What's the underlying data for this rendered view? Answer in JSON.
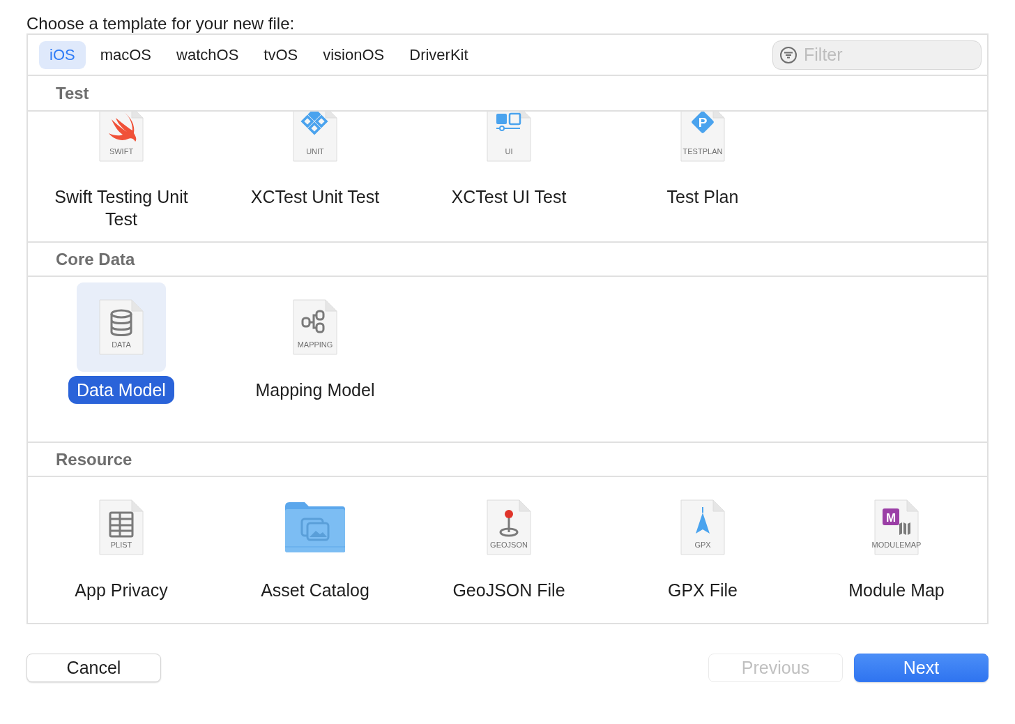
{
  "prompt": "Choose a template for your new file:",
  "tabs": [
    {
      "label": "iOS",
      "selected": true
    },
    {
      "label": "macOS",
      "selected": false
    },
    {
      "label": "watchOS",
      "selected": false
    },
    {
      "label": "tvOS",
      "selected": false
    },
    {
      "label": "visionOS",
      "selected": false
    },
    {
      "label": "DriverKit",
      "selected": false
    }
  ],
  "filter": {
    "placeholder": "Filter"
  },
  "sections": [
    {
      "title": "Test",
      "items": [
        {
          "kind": "swift",
          "badge": "SWIFT",
          "label": "Swift Testing Unit Test",
          "selected": false
        },
        {
          "kind": "unit",
          "badge": "UNIT",
          "label": "XCTest Unit Test",
          "selected": false
        },
        {
          "kind": "ui",
          "badge": "UI",
          "label": "XCTest UI Test",
          "selected": false
        },
        {
          "kind": "testplan",
          "badge": "TESTPLAN",
          "mark": "P",
          "label": "Test Plan",
          "selected": false
        }
      ]
    },
    {
      "title": "Core Data",
      "items": [
        {
          "kind": "data",
          "badge": "DATA",
          "label": "Data Model",
          "selected": true
        },
        {
          "kind": "mapping",
          "badge": "MAPPING",
          "label": "Mapping Model",
          "selected": false
        }
      ]
    },
    {
      "title": "Resource",
      "items": [
        {
          "kind": "plist",
          "badge": "PLIST",
          "label": "App Privacy",
          "selected": false
        },
        {
          "kind": "folder",
          "label": "Asset Catalog",
          "selected": false
        },
        {
          "kind": "geojson",
          "badge": "GEOJSON",
          "label": "GeoJSON File",
          "selected": false
        },
        {
          "kind": "gpx",
          "badge": "GPX",
          "label": "GPX File",
          "selected": false
        },
        {
          "kind": "modulemap",
          "badge": "MODULEMAP",
          "mark": "M",
          "label": "Module Map",
          "selected": false
        }
      ]
    }
  ],
  "buttons": [
    {
      "label": "Cancel",
      "kind": "normal",
      "disabled": false
    },
    {
      "label": "Previous",
      "kind": "normal",
      "disabled": true
    },
    {
      "label": "Next",
      "kind": "default",
      "disabled": false
    }
  ]
}
